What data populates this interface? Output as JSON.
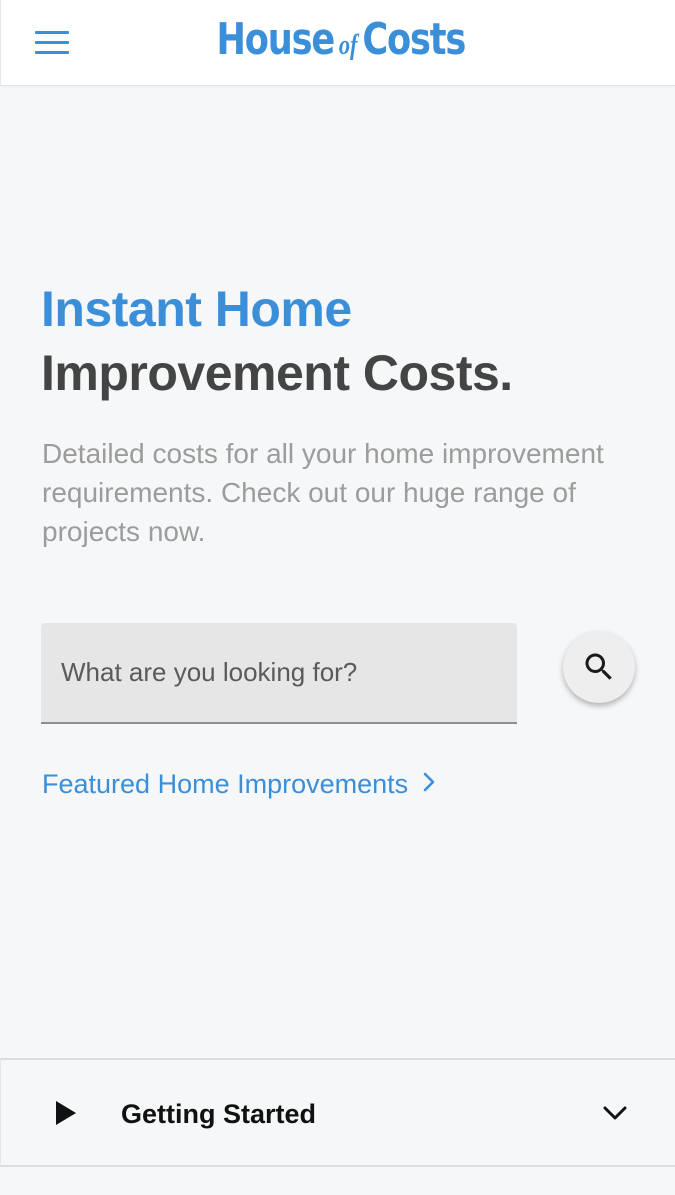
{
  "header": {
    "logo_part1": "House",
    "logo_of": "of",
    "logo_part2": "Costs",
    "menu_icon": "hamburger-menu-icon"
  },
  "hero": {
    "title_accent": "Instant Home",
    "title_main": "Improvement Costs.",
    "description": "Detailed costs for all your home improvement requirements. Check out our huge range of projects now."
  },
  "search": {
    "placeholder": "What are you looking for?",
    "value": "",
    "button_icon": "search-icon"
  },
  "featured": {
    "label": "Featured Home Improvements",
    "icon": "chevron-right-icon"
  },
  "accordion": {
    "label": "Getting Started",
    "left_icon": "play-icon",
    "right_icon": "chevron-down-icon"
  },
  "colors": {
    "accent": "#3b8fd9",
    "heading_dark": "#444444",
    "body_muted": "#9c9c9c",
    "background": "#f6f7f9"
  }
}
